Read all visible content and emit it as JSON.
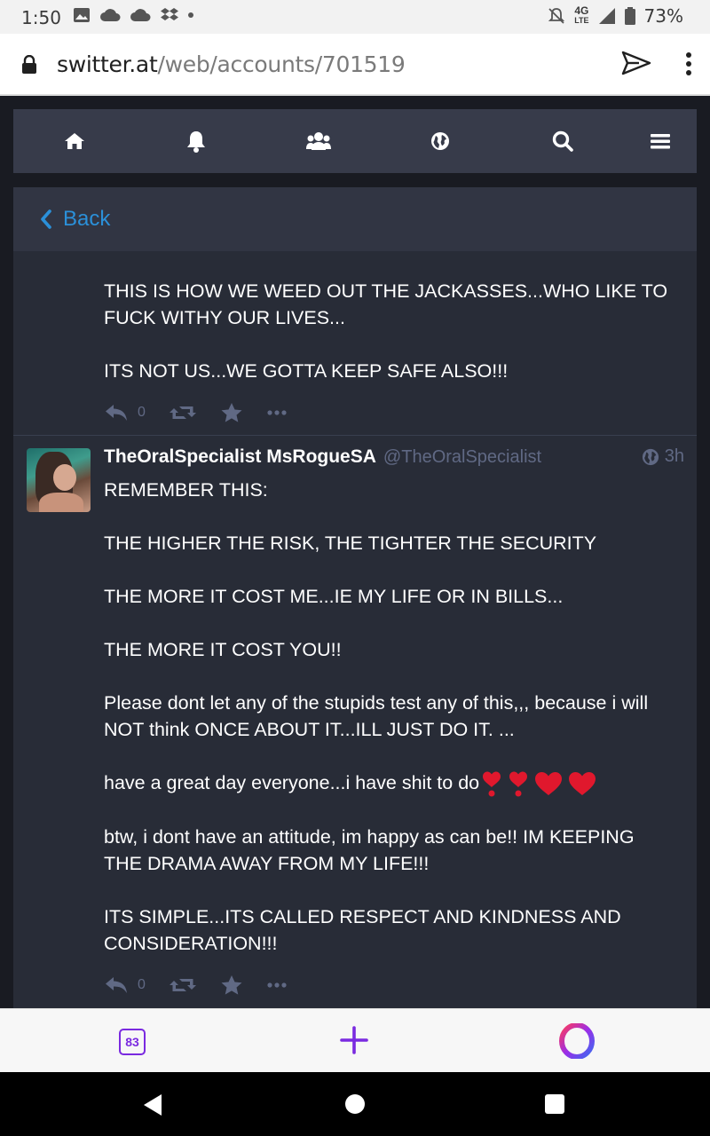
{
  "statusbar": {
    "time": "1:50",
    "network": "4G",
    "network_sub": "LTE",
    "battery": "73%"
  },
  "browser": {
    "url_domain": "switter.at",
    "url_path": "/web/accounts/701519",
    "tabs_count": "83"
  },
  "nav": {
    "items": [
      "home-icon",
      "bell-icon",
      "users-icon",
      "globe-icon",
      "search-icon",
      "menu-icon"
    ]
  },
  "column": {
    "back_label": "Back"
  },
  "statuses": [
    {
      "paragraphs": [
        "THIS IS HOW WE WEED OUT THE JACKASSES...WHO LIKE TO FUCK WITHY OUR LIVES...",
        "ITS NOT US...WE GOTTA KEEP SAFE ALSO!!!"
      ],
      "reply_count": "0"
    },
    {
      "display_name": "TheOralSpecialist MsRogueSA",
      "acct": "@TheOralSpecialist",
      "time": "3h",
      "paragraphs": [
        "REMEMBER THIS:",
        "THE HIGHER THE RISK, THE TIGHTER THE SECURITY",
        "THE MORE IT COST ME...IE MY LIFE OR IN BILLS...",
        "THE MORE IT COST YOU!!",
        "Please dont let any of the stupids test any of this,,, because i will NOT think ONCE ABOUT IT...ILL JUST DO IT. ...",
        "have a great day everyone...i have shit to do",
        "btw, i dont have an attitude, im happy as can be!! IM KEEPING THE DRAMA AWAY FROM MY LIFE!!!",
        "ITS SIMPLE...ITS CALLED RESPECT AND KINDNESS AND CONSIDERATION!!!"
      ],
      "reply_count": "0"
    }
  ],
  "colors": {
    "accent": "#2b90d9",
    "nav_bg": "#373b4a",
    "column_bg": "#282c37",
    "muted": "#606984",
    "heart": "#e0182d",
    "opera": "#7a2ae0"
  }
}
